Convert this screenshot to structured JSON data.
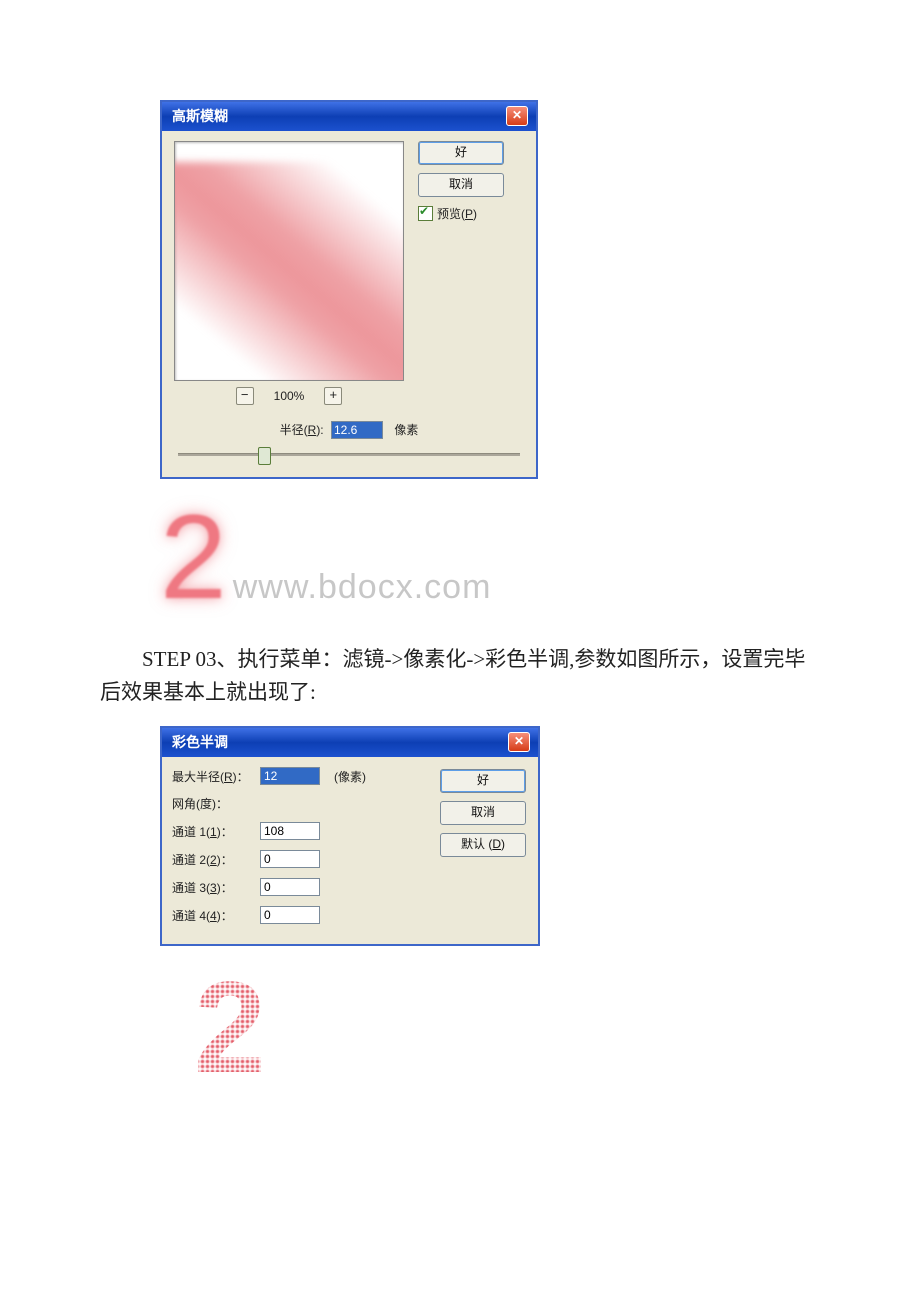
{
  "dlg1": {
    "title": "高斯模糊",
    "ok": "好",
    "cancel": "取消",
    "preview_label": "预览(P)",
    "zoom_percent": "100%",
    "radius_label": "半径(R):",
    "radius_value": "12.6",
    "radius_unit": "像素"
  },
  "mid": {
    "big2": "2",
    "watermark": "www.bdocx.com"
  },
  "para": {
    "step_en": "STEP 03",
    "text_a": "、执行菜单：滤镜->像素化->彩色半调,参数如图所示，设置完毕后效果基本上就出现了:"
  },
  "dlg2": {
    "title": "彩色半调",
    "ok": "好",
    "cancel": "取消",
    "defaults": "默认 (D)",
    "max_radius_label": "最大半径(R)：",
    "max_radius_value": "12",
    "max_radius_unit": "(像素)",
    "angle_label": "网角(度)：",
    "ch1_label": "通道 1(1)：",
    "ch1_value": "108",
    "ch2_label": "通道 2(2)：",
    "ch2_value": "0",
    "ch3_label": "通道 3(3)：",
    "ch3_value": "0",
    "ch4_label": "通道 4(4)：",
    "ch4_value": "0"
  }
}
